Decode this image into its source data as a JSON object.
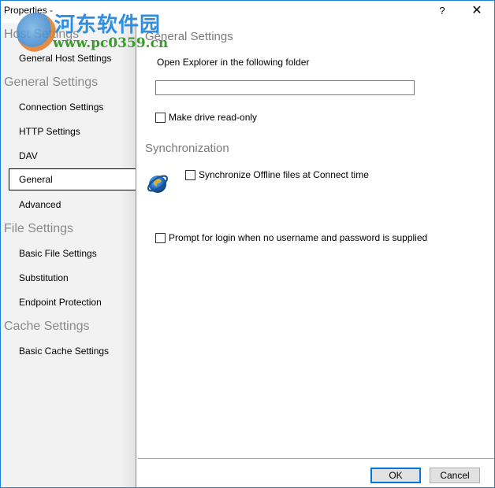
{
  "window": {
    "title": "Properties -",
    "help_label": "?",
    "close_label": "✕"
  },
  "watermark": {
    "site_name": "河东软件园",
    "url": "www.pc0359.cn"
  },
  "sidebar": {
    "groups": [
      {
        "label": "Host Settings",
        "items": [
          {
            "label": "General Host Settings"
          }
        ]
      },
      {
        "label": "General Settings",
        "items": [
          {
            "label": "Connection Settings"
          },
          {
            "label": "HTTP Settings"
          },
          {
            "label": "DAV"
          },
          {
            "label": "General",
            "selected": true
          },
          {
            "label": "Advanced"
          }
        ]
      },
      {
        "label": "File Settings",
        "items": [
          {
            "label": "Basic File Settings"
          },
          {
            "label": "Substitution"
          },
          {
            "label": "Endpoint Protection"
          }
        ]
      },
      {
        "label": "Cache Settings",
        "items": [
          {
            "label": "Basic Cache Settings"
          }
        ]
      }
    ]
  },
  "main": {
    "general_title": "General Settings",
    "folder_label": "Open Explorer in the following folder",
    "folder_value": "",
    "readonly_label": "Make drive read-only",
    "readonly_checked": false,
    "sync_title": "Synchronization",
    "sync_label": "Synchronize Offline files at Connect time",
    "sync_checked": false,
    "sync_icon": "globe-icon",
    "prompt_label": "Prompt for login when no username and password is supplied",
    "prompt_checked": false
  },
  "buttons": {
    "ok": "OK",
    "cancel": "Cancel"
  },
  "colors": {
    "accent": "#0078d7",
    "window_border": "#1883d7",
    "group_heading": "#8a8a8a"
  }
}
